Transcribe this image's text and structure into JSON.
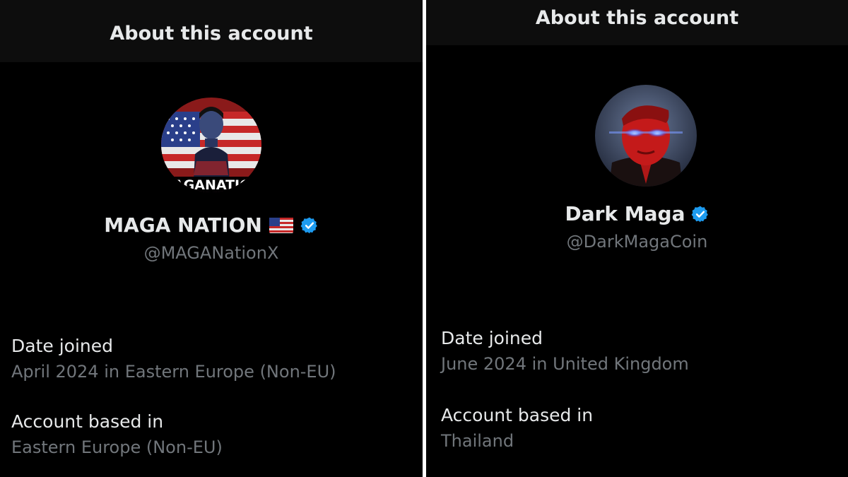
{
  "left": {
    "header_title": "About this account",
    "display_name": "MAGA NATION",
    "flag_emoji_name": "us-flag-icon",
    "handle": "@MAGANationX",
    "avatar_text": "AGANATIC",
    "date_joined_label": "Date joined",
    "date_joined_value": "April 2024 in Eastern Europe (Non-EU)",
    "based_in_label": "Account based in",
    "based_in_value": "Eastern Europe (Non-EU)"
  },
  "right": {
    "header_title": "About this account",
    "display_name": "Dark Maga",
    "handle": "@DarkMagaCoin",
    "date_joined_label": "Date joined",
    "date_joined_value": "June 2024 in United Kingdom",
    "based_in_label": "Account based in",
    "based_in_value": "Thailand"
  },
  "colors": {
    "background": "#000000",
    "header_bg": "#0d0d0d",
    "primary_text": "#e7e9ea",
    "secondary_text": "#71767b",
    "verified_blue": "#1d9bf0",
    "divider": "#ffffff"
  },
  "icons": [
    "verified-badge-icon",
    "us-flag-icon"
  ]
}
